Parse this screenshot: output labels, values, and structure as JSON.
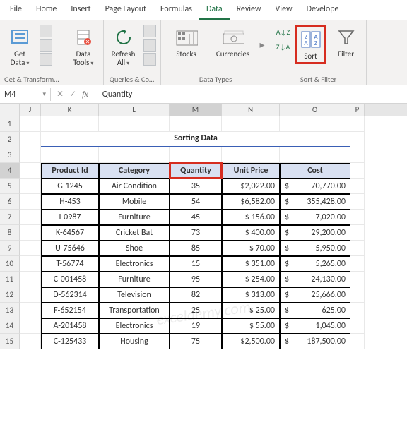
{
  "tabs": {
    "file": "File",
    "home": "Home",
    "insert": "Insert",
    "page_layout": "Page Layout",
    "formulas": "Formulas",
    "data": "Data",
    "review": "Review",
    "view": "View",
    "developer": "Develope"
  },
  "ribbon": {
    "get_data": "Get\nData",
    "data_tools": "Data\nTools",
    "refresh_all": "Refresh\nAll",
    "stocks": "Stocks",
    "currencies": "Currencies",
    "sort": "Sort",
    "filter": "Filter",
    "group_get": "Get & Transform…",
    "group_queries": "Queries & Co…",
    "group_datatypes": "Data Types",
    "group_sortfilter": "Sort & Filter"
  },
  "namebox": "M4",
  "formula": "Quantity",
  "cols": [
    "",
    "J",
    "K",
    "L",
    "M",
    "N",
    "O",
    "P"
  ],
  "title": "Sorting Data",
  "headers": [
    "Product Id",
    "Category",
    "Quantity",
    "Unit Price",
    "Cost"
  ],
  "chart_data": {
    "type": "table",
    "title": "Sorting Data",
    "columns": [
      "Product Id",
      "Category",
      "Quantity",
      "Unit Price",
      "Cost"
    ],
    "rows": [
      [
        "G-1245",
        "Air Condition",
        35,
        "$2,022.00",
        "$ 70,770.00"
      ],
      [
        "H-453",
        "Mobile",
        54,
        "$6,582.00",
        "$ 355,428.00"
      ],
      [
        "I-0987",
        "Furniture",
        45,
        "$ 156.00",
        "$ 7,020.00"
      ],
      [
        "K-64567",
        "Cricket Bat",
        73,
        "$ 400.00",
        "$ 29,200.00"
      ],
      [
        "U-75646",
        "Shoe",
        85,
        "$ 70.00",
        "$ 5,950.00"
      ],
      [
        "T-56774",
        "Electronics",
        15,
        "$ 351.00",
        "$ 5,265.00"
      ],
      [
        "C-001458",
        "Furniture",
        95,
        "$ 254.00",
        "$ 24,130.00"
      ],
      [
        "D-562314",
        "Television",
        82,
        "$ 313.00",
        "$ 25,666.00"
      ],
      [
        "F-652154",
        "Transportation",
        25,
        "$ 25.00",
        "$ 625.00"
      ],
      [
        "A-201458",
        "Electronics",
        19,
        "$ 55.00",
        "$ 1,045.00"
      ],
      [
        "C-125433",
        "Housing",
        75,
        "$2,500.00",
        "$ 187,500.00"
      ]
    ]
  },
  "watermark": "exceldemy.com",
  "rownums": [
    "1",
    "2",
    "3",
    "4",
    "5",
    "6",
    "7",
    "8",
    "9",
    "10",
    "11",
    "12",
    "13",
    "14",
    "15"
  ]
}
